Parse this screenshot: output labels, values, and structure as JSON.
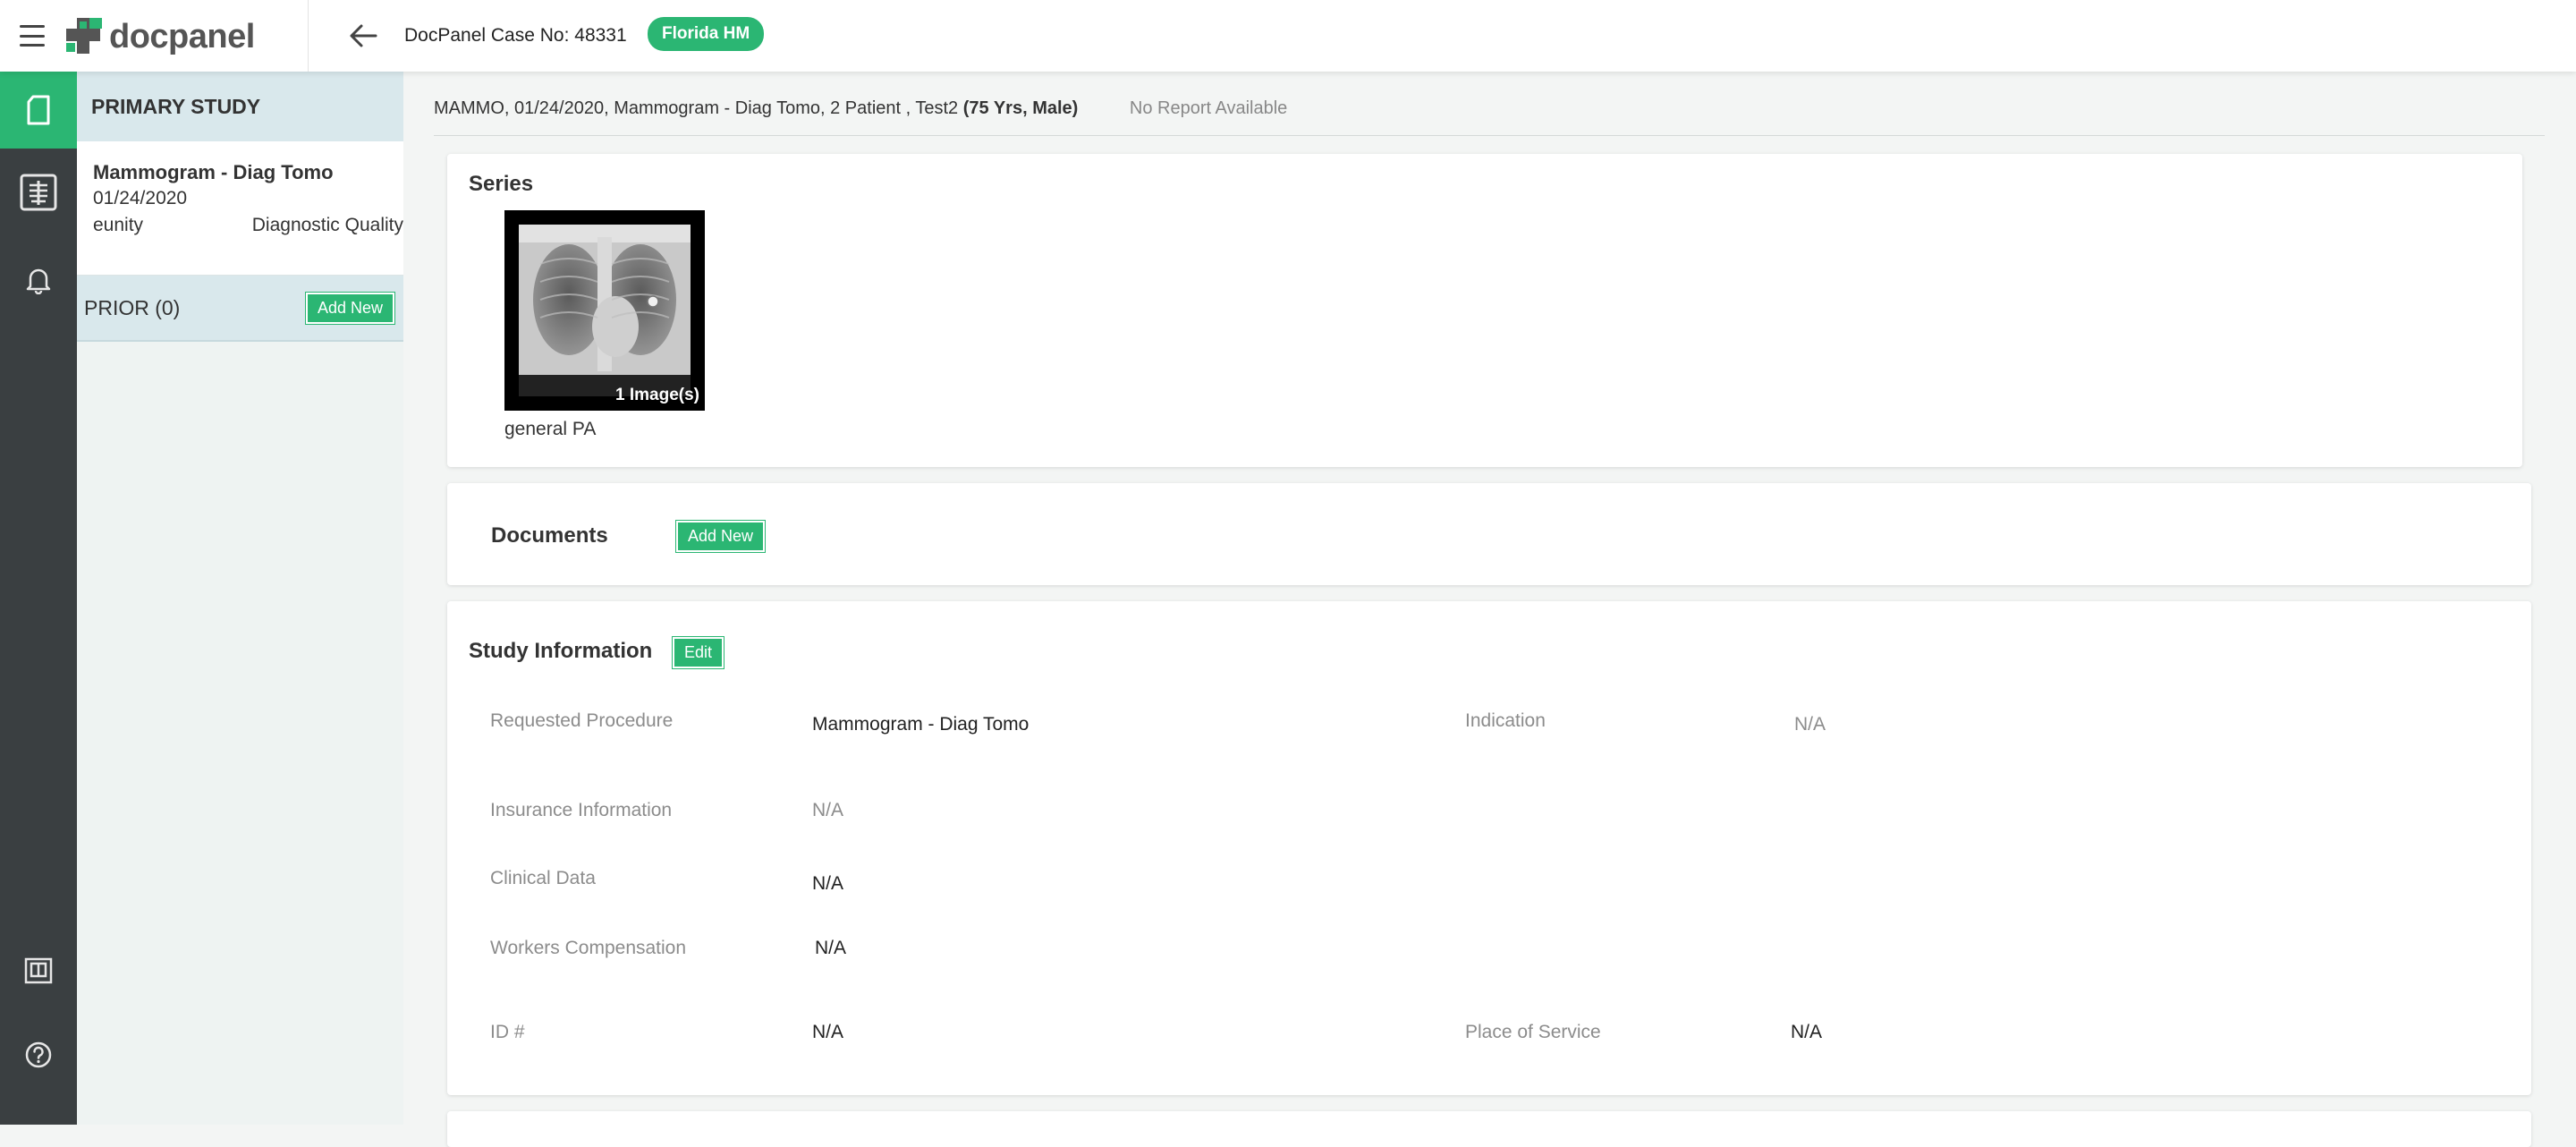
{
  "header": {
    "logo_text": "docpanel",
    "case_title": "DocPanel Case No: 48331",
    "badge": "Florida HM"
  },
  "rail": {
    "items": [
      "document-icon",
      "xray-icon",
      "bell-icon"
    ],
    "bottom_items": [
      "viewer-icon",
      "help-icon"
    ]
  },
  "sidebar": {
    "primary_title": "PRIMARY STUDY",
    "study": {
      "name": "Mammogram - Diag Tomo",
      "date": "01/24/2020",
      "source": "eunity",
      "quality": "Diagnostic Quality"
    },
    "prior_title": "PRIOR (0)",
    "prior_add": "Add New"
  },
  "main": {
    "info_line": "MAMMO, 01/24/2020, Mammogram - Diag Tomo, 2 Patient , Test2",
    "age_sex": "(75 Yrs, Male)",
    "report_status": "No Report Available",
    "series": {
      "title": "Series",
      "items": [
        {
          "count_label": "1 Image(s)",
          "name": "general PA"
        }
      ]
    },
    "documents": {
      "title": "Documents",
      "add_label": "Add New"
    },
    "study_info": {
      "title": "Study Information",
      "edit_label": "Edit",
      "requested_procedure_label": "Requested Procedure",
      "requested_procedure_value": "Mammogram - Diag Tomo",
      "indication_label": "Indication",
      "indication_value": "N/A",
      "insurance_label": "Insurance Information",
      "insurance_value": "N/A",
      "clinical_label": "Clinical Data",
      "clinical_value": "N/A",
      "workers_label": "Workers Compensation",
      "workers_value": "N/A",
      "id_label": "ID #",
      "id_value": "N/A",
      "place_label": "Place of Service",
      "place_value": "N/A"
    }
  },
  "colors": {
    "accent": "#2bb673",
    "rail": "#3a3f41",
    "sidebar_header": "#d9e8ec"
  }
}
